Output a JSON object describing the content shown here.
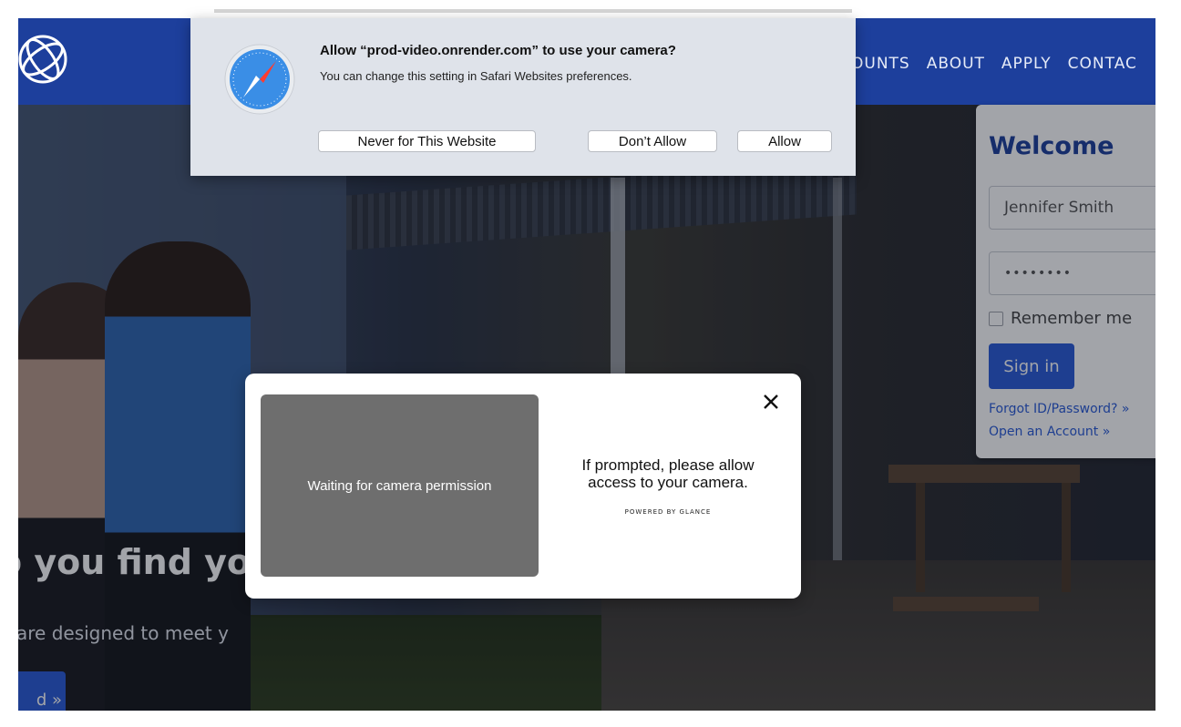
{
  "site": {
    "nav": [
      "OUNTS",
      "ABOUT",
      "APPLY",
      "CONTAC"
    ],
    "hero_heading": "o you find you",
    "hero_subtext": "are designed to meet y",
    "hero_button": "d »"
  },
  "login": {
    "title": "Welcome",
    "username": "Jennifer Smith",
    "password": "••••••••",
    "remember": "Remember me",
    "signin": "Sign in",
    "forgot": "Forgot ID/Password? »",
    "open_account": "Open an Account »"
  },
  "permission_sheet": {
    "title": "Allow “prod-video.onrender.com” to use your camera?",
    "subtitle": "You can change this setting in Safari Websites preferences.",
    "never": "Never for This Website",
    "dont_allow": "Don’t Allow",
    "allow": "Allow"
  },
  "glance_modal": {
    "camera_status": "Waiting for camera permission",
    "message": "If prompted, please allow access to your camera.",
    "powered_by": "POWERED BY GLANCE"
  },
  "colors": {
    "navbar": "#1d3f9c",
    "primary_button": "#2a5bd7"
  }
}
